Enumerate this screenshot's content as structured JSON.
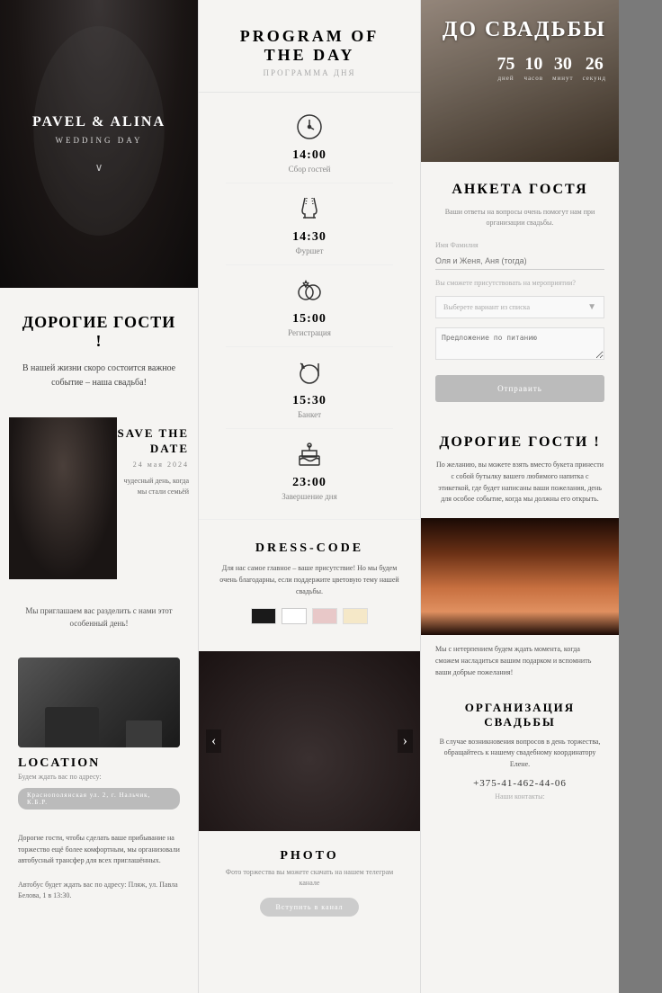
{
  "left": {
    "hero": {
      "names": "PAVEL & ALINA",
      "subtitle": "WEDDING DAY",
      "chevron": "∨"
    },
    "dear_guests": {
      "title": "ДОРОГИЕ ГОСТИ !",
      "text": "В нашей жизни скоро состоится важное событие – наша свадьба!"
    },
    "save": {
      "label_line1": "SAVE THE",
      "label_line2": "DATE",
      "date": "24 мая 2024",
      "caption_line1": "чудесный день, когда",
      "caption_line2": "мы стали семьёй"
    },
    "invite": {
      "text": "Мы приглашаем вас разделить с нами этот особенный день!"
    },
    "location": {
      "title": "LOCATION",
      "subtitle": "Будем ждать вас по адресу:",
      "address_btn": "Краснополянская ул. 2, г. Нальчик, К.Б.Р."
    },
    "transport": {
      "text": "Дорогие гости, чтобы сделать ваше прибывание на торжество ещё более комфортным, мы организовали автобусный трансфер для всех приглашённых."
    },
    "bus": {
      "text": "Автобус будет ждать вас по адресу: Пляж, ул. Павла Белова, 1 в 13:30."
    }
  },
  "mid": {
    "program": {
      "title": "PROGRAM OF THE DAY",
      "subtitle": "ПРОГРАММА ДНЯ",
      "items": [
        {
          "icon": "clock",
          "time": "14:00",
          "desc": "Сбор гостей"
        },
        {
          "icon": "champagne",
          "time": "14:30",
          "desc": "Фуршет"
        },
        {
          "icon": "rings",
          "time": "15:00",
          "desc": "Регистрация"
        },
        {
          "icon": "dinner",
          "time": "15:30",
          "desc": "Банкет"
        },
        {
          "icon": "cake",
          "time": "23:00",
          "desc": "Завершение дня"
        }
      ]
    },
    "dresscode": {
      "title": "DRESS-CODE",
      "text": "Для нас самое главное – ваше присутствие! Но мы будем очень благодарны, если поддержите цветовую тему нашей свадьбы.",
      "colors": [
        "#1a1a1a",
        "#ffffff",
        "#e8c8c8",
        "#f5e8c8"
      ]
    },
    "photo": {
      "title": "PHOTO",
      "subtitle": "Фото торжества вы можете скачать на нашем телеграм канале",
      "btn": "Вступить в канал",
      "prev": "‹",
      "next": "›"
    }
  },
  "right": {
    "countdown": {
      "to_label": "ДО СВАДЬБЫ",
      "units": [
        {
          "num": "75",
          "label": "дней"
        },
        {
          "num": "10",
          "label": "часов"
        },
        {
          "num": "30",
          "label": "минут"
        },
        {
          "num": "26",
          "label": "секунд"
        }
      ]
    },
    "guest_form": {
      "title": "АНКЕТА ГОСТЯ",
      "desc": "Ваши ответы на вопросы очень помогут нам при организации свадьбы.",
      "name_label": "Имя Фамилия",
      "name_placeholder": "Оля и Женя, Аня (тогда)",
      "attend_label": "Вы сможете присутствовать на мероприятии?",
      "select_placeholder": "Выберете вариант из списка",
      "comment_placeholder": "Предложение по питанию",
      "submit_label": "Отправить"
    },
    "dear_guests_right": {
      "title": "ДОРОГИЕ ГОСТИ !",
      "text": "По желанию, вы можете взять вместо букета принести с собой бутылку вашего любимого напитка с этикеткой, где будет написаны ваши пожелания, день для особое событие, когда мы должны его открыть."
    },
    "wait_text": "Мы с нетерпением будем ждать момента, когда сможем насладиться вашим подарком и вспомнить ваши добрые пожелания!",
    "org": {
      "title": "ОРГАНИЗАЦИЯ СВАДЬБЫ",
      "text": "В случае возникновения вопросов в день торжества, обращайтесь к нашему свадебному координатору Елене.",
      "phone": "+375-41-462-44-06",
      "contact_label": "Наши контакты:"
    }
  }
}
